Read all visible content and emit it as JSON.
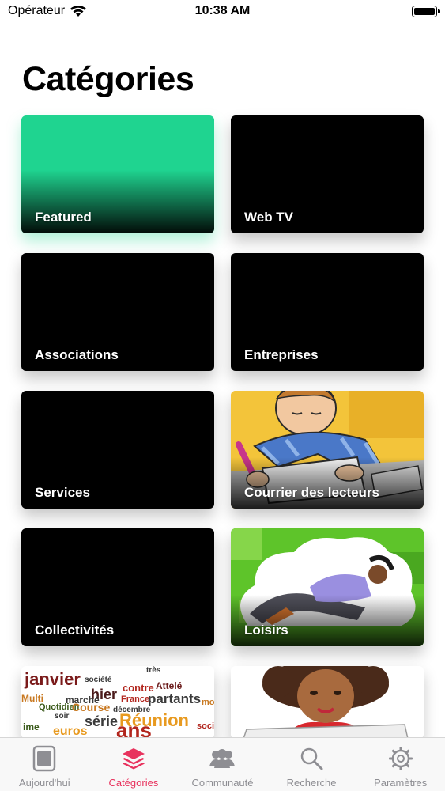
{
  "status_bar": {
    "carrier": "Opérateur",
    "time": "10:38 AM"
  },
  "page_title": "Catégories",
  "categories": [
    {
      "label": "Featured"
    },
    {
      "label": "Web TV"
    },
    {
      "label": "Associations"
    },
    {
      "label": "Entreprises"
    },
    {
      "label": "Services"
    },
    {
      "label": "Courrier des lecteurs"
    },
    {
      "label": "Collectivités"
    },
    {
      "label": "Loisirs"
    }
  ],
  "word_cloud": {
    "words": [
      "janvier",
      "société",
      "contre",
      "très",
      "Attelé",
      "hier",
      "Multi",
      "marché",
      "Quotidien",
      "France",
      "partants",
      "décembre",
      "Course",
      "série",
      "Réunion",
      "soir",
      "mois",
      "euros",
      "ans",
      "ime",
      "soci"
    ]
  },
  "tab_bar": {
    "items": [
      {
        "label": "Aujourd'hui",
        "icon": "today-icon"
      },
      {
        "label": "Catégories",
        "icon": "layers-icon"
      },
      {
        "label": "Communauté",
        "icon": "people-icon"
      },
      {
        "label": "Recherche",
        "icon": "search-icon"
      },
      {
        "label": "Paramètres",
        "icon": "gear-icon"
      }
    ],
    "active_index": 1
  },
  "colors": {
    "accent": "#e8335e",
    "featured": "#1fd490",
    "inactive": "#8e8e93"
  }
}
